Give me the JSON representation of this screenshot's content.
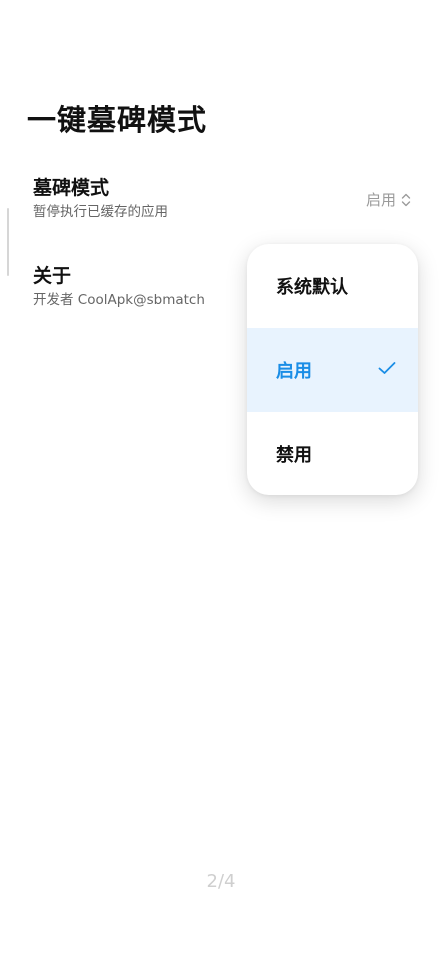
{
  "page": {
    "title": "一键墓碑模式"
  },
  "settings": [
    {
      "title": "墓碑模式",
      "subtitle": "暂停执行已缓存的应用",
      "value": "启用"
    },
    {
      "title": "关于",
      "subtitle": "开发者 CoolApk@sbmatch"
    }
  ],
  "dropdown": {
    "options": [
      "系统默认",
      "启用",
      "禁用"
    ],
    "selected": "启用"
  },
  "pager": {
    "text": "2/4"
  },
  "colors": {
    "accent": "#1a8de6",
    "selected_bg": "#e8f3fe",
    "muted_text": "#9a9a9a"
  },
  "icons": {
    "value_selector": "updown-chevron-icon",
    "selected_mark": "check-icon"
  }
}
